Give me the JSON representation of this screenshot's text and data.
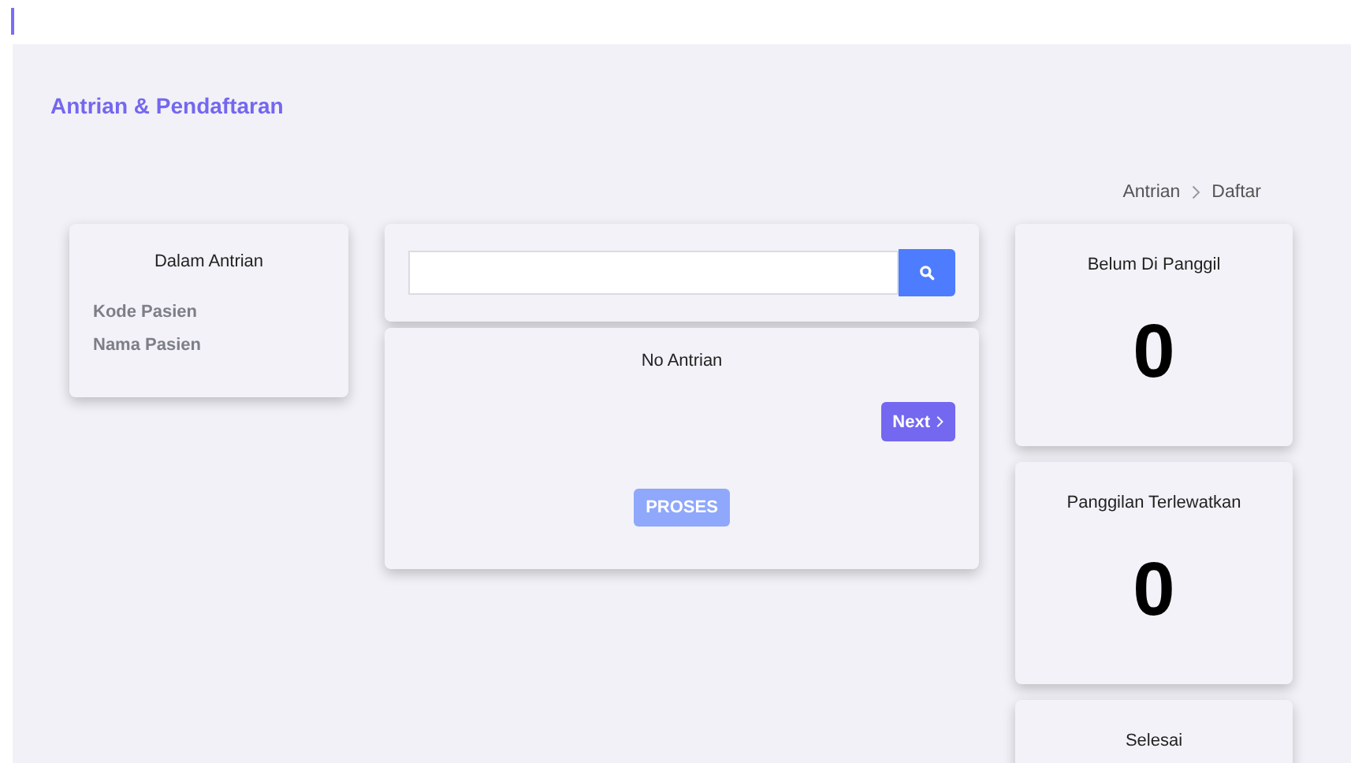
{
  "page_title": "Antrian & Pendaftaran",
  "breadcrumb": [
    "Antrian",
    "Daftar"
  ],
  "patient_card": {
    "title": "Dalam Antrian",
    "fields": [
      "Kode Pasien",
      "Nama Pasien"
    ]
  },
  "queue_card": {
    "title": "No Antrian",
    "next_button": "Next",
    "process_button": {
      "label": "PROSES",
      "disabled": true
    }
  },
  "stats": [
    {
      "title": "Belum Di Panggil",
      "value": "0"
    },
    {
      "title": "Panggilan Terlewatkan",
      "value": "0"
    },
    {
      "title": "Selesai"
    }
  ]
}
